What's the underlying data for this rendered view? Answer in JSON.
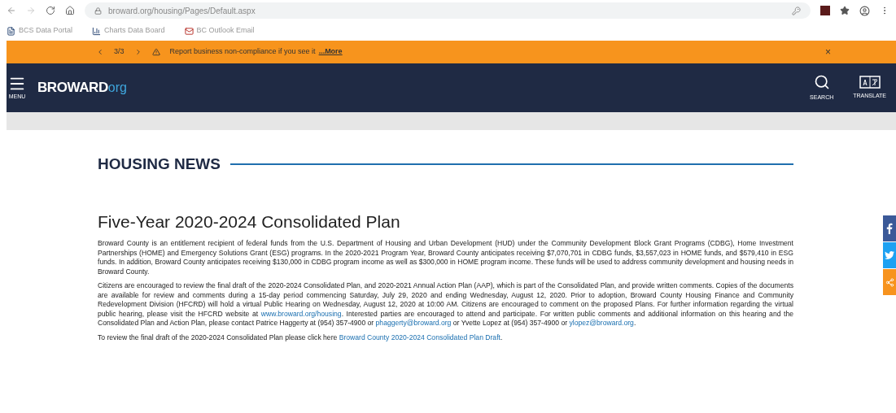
{
  "browser": {
    "url": "broward.org/housing/Pages/Default.aspx",
    "bookmarks": [
      {
        "label": "BCS Data Portal"
      },
      {
        "label": "Charts Data Board"
      },
      {
        "label": "BC Outlook Email"
      }
    ]
  },
  "alert": {
    "counter": "3/3",
    "message": "Report business non-compliance if you see it",
    "link": "...More",
    "close": "×"
  },
  "header": {
    "menu_label": "MENU",
    "logo_main": "BROWARD",
    "logo_suffix": "org",
    "actions": [
      {
        "kind": "search",
        "label": "SEARCH"
      },
      {
        "kind": "translate",
        "label": "TRANSLATE"
      }
    ]
  },
  "section_title": "HOUSING NEWS",
  "article": {
    "title": "Five-Year 2020-2024 Consolidated Plan",
    "paragraphs": [
      [
        {
          "text": "Broward County is an entitlement recipient of federal funds from the U.S. Department of Housing and Urban Development (HUD) under the Community Development Block Grant Programs (CDBG), Home Investment Partnerships (HOME) and Emergency Solutions Grant (ESG) programs. In the 2020-2021 Program Year, Broward County anticipates receiving $7,070,701 in CDBG funds, $3,557,023 in HOME funds, and $579,410 in ESG funds. In addition, Broward County anticipates receiving $130,000 in CDBG program income as well as $300,000 in HOME program income. These funds will be used to address community development and housing needs in Broward County."
        }
      ],
      [
        {
          "text": "Citizens are encouraged to review the final draft of the 2020-2024 Consolidated Plan, and 2020-2021 Annual Action Plan (AAP), which is part of the Consolidated Plan, and provide written comments. Copies of the documents are available for review and comments during a 15-day period commencing Saturday, July 29, 2020 and ending Wednesday, August 12, 2020. Prior to adoption, Broward County Housing Finance and Community Redevelopment Division (HFCRD) will hold a virtual Public Hearing on Wednesday, August 12, 2020 at 10:00 AM. Citizens are encouraged to comment on the proposed Plans. For further information regarding the virtual public hearing, please visit the HFCRD website at "
        },
        {
          "link": "www.broward.org/housing"
        },
        {
          "text": ". Interested parties are encouraged to attend and participate. For written public comments and additional information on this hearing and the Consolidated Plan and Action Plan, please contact Patrice Haggerty at (954) 357-4900 or "
        },
        {
          "link": "phaggerty@broward.org"
        },
        {
          "text": " or Yvette Lopez at (954) 357-4900 or "
        },
        {
          "link": "ylopez@broward.org"
        },
        {
          "text": "."
        }
      ],
      [
        {
          "text": "To review the final draft of the 2020-2024 Consolidated Plan please click here "
        },
        {
          "link": "Broward County 2020-2024 Consolidated Plan Draft"
        },
        {
          "text": "."
        }
      ]
    ]
  },
  "social": [
    {
      "kind": "facebook",
      "color": "#3b5998"
    },
    {
      "kind": "twitter",
      "color": "#1da1f2"
    },
    {
      "kind": "share",
      "color": "#f7931e"
    }
  ]
}
